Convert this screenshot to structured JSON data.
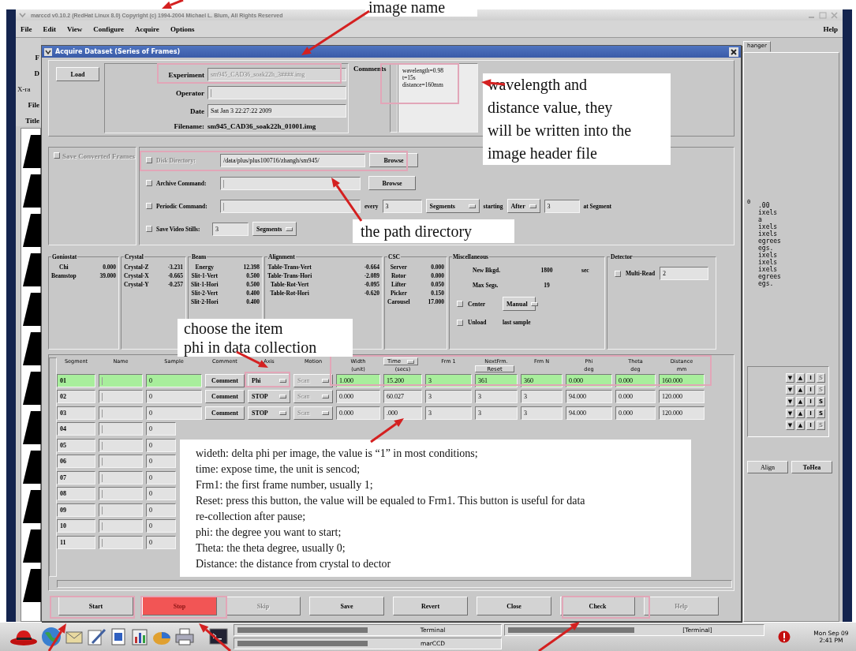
{
  "app": {
    "title": "marccd  v0.10.2 (RedHat Linux 8.0) Copyright (c) 1994-2004 Michael L. Blum, All Rights Reserved",
    "menu": [
      {
        "label": "File"
      },
      {
        "label": "Edit"
      },
      {
        "label": "View"
      },
      {
        "label": "Configure"
      },
      {
        "label": "Acquire"
      },
      {
        "label": "Options"
      }
    ],
    "help": "Help"
  },
  "background_window": {
    "left_labels": [
      "F",
      "D",
      "X-ra",
      "File",
      "Title"
    ],
    "tab": "hanger",
    "value": "0",
    "readouts": [
      ".00",
      "ixels",
      "a",
      "ixels",
      "ixels",
      "egrees",
      "egs.",
      "ixels",
      "ixels",
      "ixels",
      "egrees",
      "egs."
    ],
    "control_rows": [
      {
        "buttons": [
          {
            "label": "▼",
            "disabled": false
          },
          {
            "label": "▲",
            "disabled": false
          },
          {
            "label": "I",
            "disabled": false
          },
          {
            "label": "S",
            "disabled": true
          }
        ]
      },
      {
        "buttons": [
          {
            "label": "▼",
            "disabled": false
          },
          {
            "label": "▲",
            "disabled": false
          },
          {
            "label": "I",
            "disabled": false
          },
          {
            "label": "S",
            "disabled": true
          }
        ]
      },
      {
        "buttons": [
          {
            "label": "▼",
            "disabled": false
          },
          {
            "label": "▲",
            "disabled": false
          },
          {
            "label": "I",
            "disabled": false
          },
          {
            "label": "S",
            "disabled": false
          }
        ]
      },
      {
        "buttons": [
          {
            "label": "▼",
            "disabled": false
          },
          {
            "label": "▲",
            "disabled": false
          },
          {
            "label": "I",
            "disabled": false
          },
          {
            "label": "S",
            "disabled": false
          }
        ]
      },
      {
        "buttons": [
          {
            "label": "▼",
            "disabled": false
          },
          {
            "label": "▲",
            "disabled": false
          },
          {
            "label": "I",
            "disabled": false
          },
          {
            "label": "S",
            "disabled": true
          }
        ]
      }
    ],
    "buttons": [
      "Align",
      "ToHea"
    ]
  },
  "dialog": {
    "title": "Acquire Dataset (Series of Frames)",
    "load": "Load",
    "fields": [
      {
        "label": "Experiment",
        "value": "sm945_CAD36_soak22h_3####.img",
        "disabled": true
      },
      {
        "label": "Operator",
        "disabled": false
      },
      {
        "label": "Date",
        "value": "Sat Jan 3 22:27:22 2009",
        "disabled": false
      }
    ],
    "filename": {
      "label": "Filename:",
      "value": "sm945_CAD36_soak22h_01001.img"
    },
    "comments": {
      "label": "Comments",
      "lines": [
        "wavelength=0.98",
        "t=15s",
        "distance=160mm"
      ]
    },
    "save": {
      "save_converted": {
        "label": "Save Converted Frames",
        "checked": false,
        "disabled": true
      },
      "disk_directory": {
        "label": "Disk Directory:",
        "checked": false,
        "disabled": true,
        "value": "/data/plus/plus100716/zhangh/sm945/",
        "button": "Browse"
      },
      "archive": {
        "label": "Archive Command:",
        "checked": false,
        "button": "Browse"
      },
      "periodic": {
        "label": "Periodic Command:",
        "checked": false,
        "every_label": "every",
        "every": "3",
        "unit": "Segments",
        "starting_label": "starting",
        "when": "After",
        "at": "3",
        "at_label": "at Segment"
      },
      "video": {
        "label": "Save Video Stills:",
        "checked": false,
        "value": "3",
        "unit": "Segments"
      }
    },
    "status": [
      {
        "title": "Goniostat",
        "kind": "readout",
        "rows": [
          {
            "label": "Chi",
            "value": "0.000"
          },
          {
            "label": "Beamstop",
            "value": "39.000"
          }
        ]
      },
      {
        "title": "Crystal",
        "kind": "readout",
        "rows": [
          {
            "label": "Crystal-Z",
            "value": "-3.231"
          },
          {
            "label": "Crystal-X",
            "value": "-0.665"
          },
          {
            "label": "Crystal-Y",
            "value": "-0.257"
          }
        ]
      },
      {
        "title": "Beam",
        "kind": "readout",
        "rows": [
          {
            "label": "Energy",
            "value": "12.398"
          },
          {
            "label": "Slit-1-Vert",
            "value": "0.500"
          },
          {
            "label": "Slit-1-Hori",
            "value": "0.500"
          },
          {
            "label": "Slit-2-Vert",
            "value": "0.400"
          },
          {
            "label": "Slit-2-Hori",
            "value": "0.400"
          }
        ]
      },
      {
        "title": "Alignment",
        "kind": "readout",
        "rows": [
          {
            "label": "Table-Trans-Vert",
            "value": "-0.664"
          },
          {
            "label": "Table-Trans-Hori",
            "value": "-2.089"
          },
          {
            "label": "Table-Rot-Vert",
            "value": "-0.095"
          },
          {
            "label": "Table-Rot-Hori",
            "value": "-0.620"
          }
        ]
      },
      {
        "title": "CSC",
        "kind": "readout",
        "rows": [
          {
            "label": "Server",
            "value": "0.000"
          },
          {
            "label": "Rotor",
            "value": "0.000"
          },
          {
            "label": "Lifter",
            "value": "0.050"
          },
          {
            "label": "Picker",
            "value": "0.150"
          },
          {
            "label": "Carousel",
            "value": "17.000"
          }
        ]
      },
      {
        "title": "Miscellaneous",
        "kind": "misc",
        "rows": [
          {
            "label": "New Bkgd.",
            "value": "1800",
            "unit": "sec"
          },
          {
            "label": "Max Segs.",
            "value": "19"
          }
        ],
        "center": {
          "label": "Center",
          "checked": false,
          "value": "Manual"
        },
        "unload": {
          "label": "Unload",
          "checked": false,
          "value": "last sample"
        }
      },
      {
        "title": "Detector",
        "kind": "detector",
        "multi_read": {
          "label": "Multi-Read",
          "checked": false,
          "value": "2"
        }
      }
    ],
    "table": {
      "columns": [
        {
          "label": "Segment"
        },
        {
          "label": "Name"
        },
        {
          "label": "Sample"
        },
        {
          "label": "Comment"
        },
        {
          "label": "Axis"
        },
        {
          "label": "Motion"
        },
        {
          "label": "Width",
          "sub": "(unit)"
        },
        {
          "label": "Time",
          "sub": "(secs)",
          "kind": "dropdown"
        },
        {
          "label": "Frm 1"
        },
        {
          "label": "NextFrm.",
          "button": "Reset"
        },
        {
          "label": "Frm N"
        },
        {
          "label": "Phi",
          "sub": "deg"
        },
        {
          "label": "Theta",
          "sub": "deg"
        },
        {
          "label": "Distance",
          "sub": "mm"
        }
      ],
      "rows": [
        {
          "selected": true,
          "segment": "01",
          "sample": "0",
          "comment": "Comment",
          "axis": "Phi",
          "motion": "Scan",
          "values": [
            "1.000",
            "15.200",
            "3",
            "361",
            "360",
            "0.000",
            "0.000",
            "160.000"
          ]
        },
        {
          "selected": false,
          "segment": "02",
          "sample": "0",
          "comment": "Comment",
          "axis": "STOP",
          "motion": "Scan",
          "values": [
            "0.000",
            "60.027",
            "3",
            "3",
            "3",
            "94.000",
            "0.000",
            "120.000"
          ]
        },
        {
          "selected": false,
          "segment": "03",
          "sample": "0",
          "comment": "Comment",
          "axis": "STOP",
          "motion": "Scan",
          "values": [
            "0.000",
            ".000",
            "3",
            "3",
            "3",
            "94.000",
            "0.000",
            "120.000"
          ]
        },
        {
          "selected": false,
          "segment": "04",
          "sample": "0"
        },
        {
          "selected": false,
          "segment": "05",
          "sample": "0"
        },
        {
          "selected": false,
          "segment": "06",
          "sample": "0"
        },
        {
          "selected": false,
          "segment": "07",
          "sample": "0"
        },
        {
          "selected": false,
          "segment": "08",
          "sample": "0"
        },
        {
          "selected": false,
          "segment": "09",
          "sample": "0"
        },
        {
          "selected": false,
          "segment": "10",
          "sample": "0"
        },
        {
          "selected": false,
          "segment": "11",
          "sample": "0"
        }
      ]
    },
    "buttons": [
      {
        "label": "Start",
        "kind": "normal",
        "disabled": false
      },
      {
        "label": "Stop",
        "kind": "alert",
        "disabled": true
      },
      {
        "label": "Skip",
        "kind": "normal",
        "disabled": true
      },
      {
        "label": "Save",
        "kind": "normal",
        "disabled": false
      },
      {
        "label": "Revert",
        "kind": "normal",
        "disabled": false
      },
      {
        "label": "Close",
        "kind": "normal",
        "disabled": false
      },
      {
        "label": "Check",
        "kind": "normal",
        "disabled": false
      },
      {
        "label": "Help",
        "kind": "normal",
        "disabled": true
      }
    ]
  },
  "taskbar": {
    "tasks": [
      {
        "label": "Terminal"
      },
      {
        "label": "marCCD"
      },
      {
        "label": "[Terminal]"
      }
    ],
    "clock": [
      "Mon Sep 09",
      "2:41 PM"
    ]
  },
  "annotations": [
    {
      "lines": [
        "image name"
      ]
    },
    {
      "lines": [
        "wavelength and",
        "distance value, they",
        "will be written into the",
        "image header file"
      ]
    },
    {
      "lines": [
        "the path directory"
      ]
    },
    {
      "lines": [
        "choose the item",
        "phi in data collection"
      ]
    },
    {
      "lines": [
        "wideth: delta phi per image, the value is “1” in most conditions;",
        "time: expose time, the unit is sencod;",
        "Frm1: the first frame number, usually 1;",
        "Reset: press this button, the value will be equaled to Frm1. This button is useful for data",
        "re-collection after pause;",
        "phi: the degree you want to start;",
        "Theta: the theta degree, usually 0;",
        "Distance: the distance from crystal to dector"
      ]
    }
  ]
}
